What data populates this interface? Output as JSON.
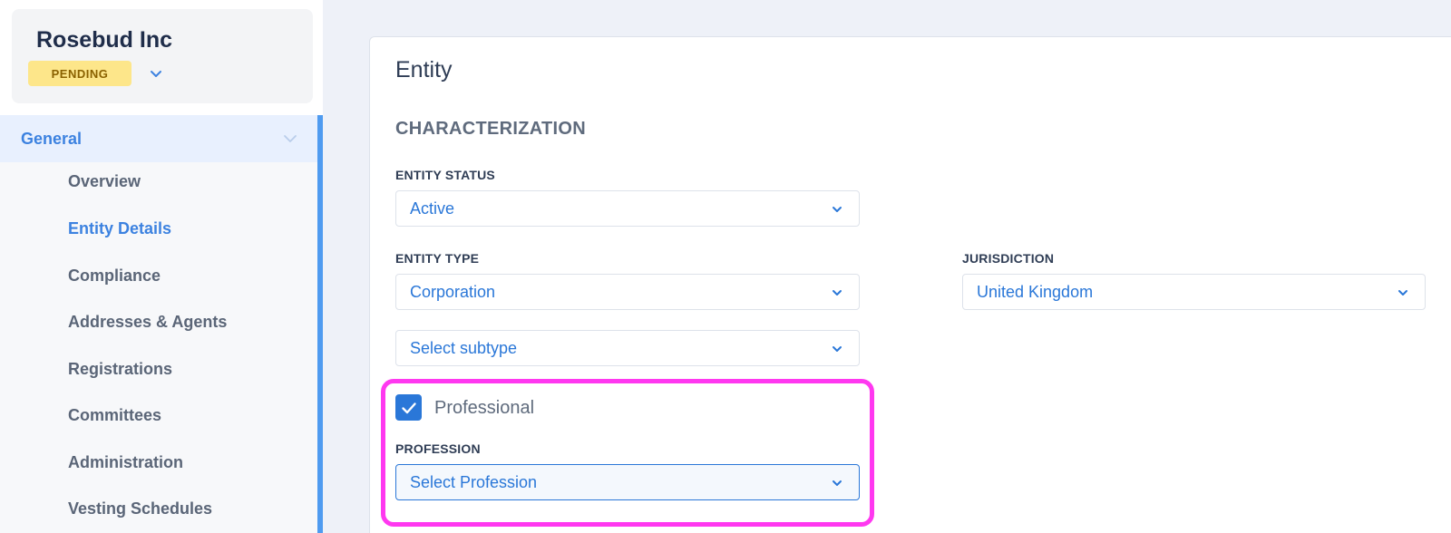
{
  "company": {
    "name": "Rosebud Inc",
    "status": "PENDING"
  },
  "nav": {
    "section": "General",
    "items": [
      {
        "label": "Overview",
        "active": false
      },
      {
        "label": "Entity Details",
        "active": true
      },
      {
        "label": "Compliance",
        "active": false
      },
      {
        "label": "Addresses & Agents",
        "active": false
      },
      {
        "label": "Registrations",
        "active": false
      },
      {
        "label": "Committees",
        "active": false
      },
      {
        "label": "Administration",
        "active": false
      },
      {
        "label": "Vesting Schedules",
        "active": false
      }
    ]
  },
  "panel": {
    "title": "Entity",
    "section_title": "CHARACTERIZATION",
    "entity_status": {
      "label": "ENTITY STATUS",
      "value": "Active"
    },
    "entity_type": {
      "label": "ENTITY TYPE",
      "value": "Corporation"
    },
    "jurisdiction": {
      "label": "JURISDICTION",
      "value": "United Kingdom"
    },
    "subtype": {
      "placeholder": "Select subtype"
    },
    "professional": {
      "label": "Professional",
      "checked": true
    },
    "profession": {
      "label": "PROFESSION",
      "placeholder": "Select Profession"
    }
  },
  "colors": {
    "accent": "#2a77d8",
    "highlight": "#ff38f0",
    "badge_bg": "#fde68a",
    "nav_active_bg": "#e8f0fe"
  },
  "icons": {
    "dropdown": "chevron-down-icon",
    "checkbox": "checkmark-icon"
  }
}
